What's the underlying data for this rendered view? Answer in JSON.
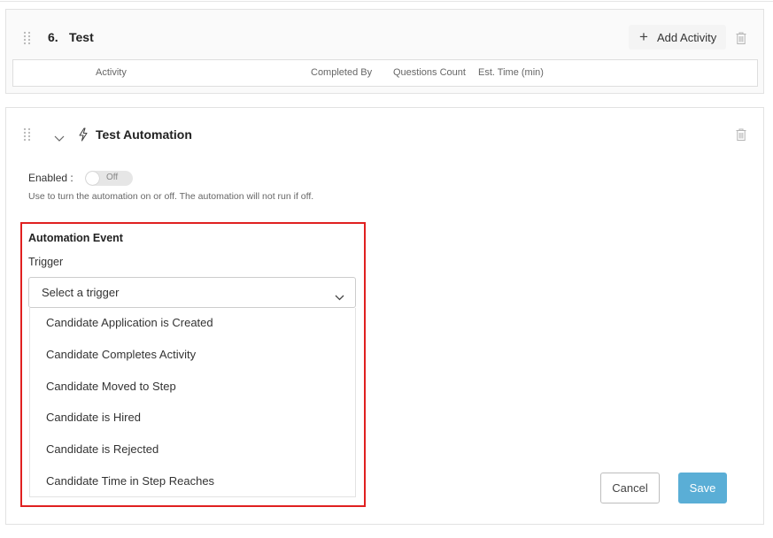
{
  "step": {
    "number": "6.",
    "name": "Test",
    "add_activity_label": "Add Activity",
    "table_headers": [
      "Activity",
      "Completed By",
      "Questions Count",
      "Est. Time (min)"
    ]
  },
  "automation": {
    "title": "Test Automation",
    "enabled_label": "Enabled :",
    "toggle_state": "Off",
    "help_text": "Use to turn the automation on or off. The automation will not run if off.",
    "event_heading": "Automation Event",
    "trigger_label": "Trigger",
    "trigger_placeholder": "Select a trigger",
    "trigger_options": [
      "Candidate Application is Created",
      "Candidate Completes Activity",
      "Candidate Moved to Step",
      "Candidate is Hired",
      "Candidate is Rejected",
      "Candidate Time in Step Reaches"
    ],
    "cancel_label": "Cancel",
    "save_label": "Save"
  },
  "icons": {
    "drag": "drag-handle-icon",
    "add": "plus-icon",
    "delete": "trash-icon",
    "collapse": "chevron-down-icon",
    "automation": "lightning-bolt-icon",
    "dropdown_caret": "chevron-down-icon"
  },
  "colors": {
    "highlight": "#e02020",
    "save_button": "#5aaed6",
    "card_border": "#e2e2e2"
  }
}
